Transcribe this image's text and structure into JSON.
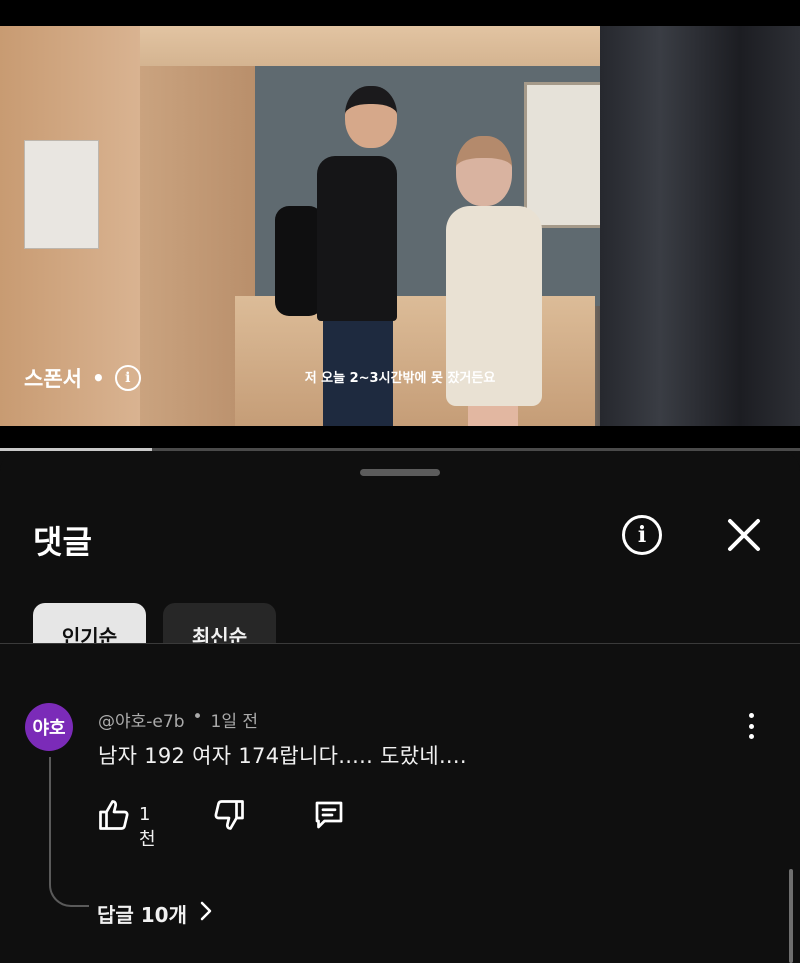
{
  "video": {
    "sponsor_label": "스폰서",
    "sponsor_dot": "•",
    "info_glyph": "i",
    "subtitle": "저 오늘 2~3시간밖에 못 잤거든요",
    "progress_fraction": 0.19
  },
  "comments_sheet": {
    "title": "댓글",
    "info_icon": "info-icon",
    "close_icon": "close-icon",
    "sort_chips": [
      {
        "label": "인기순",
        "selected": true
      },
      {
        "label": "최신순",
        "selected": false
      }
    ]
  },
  "comment": {
    "avatar_text": "야호",
    "avatar_color": "#7b2bb8",
    "author": "@야호-e7b",
    "separator": "•",
    "time": "1일 전",
    "text": "남자 192 여자 174랍니다..... 도랐네....",
    "like_count": "1천",
    "like_icon": "thumbs-up-icon",
    "dislike_icon": "thumbs-down-icon",
    "reply_icon": "reply-icon",
    "menu_icon": "more-vertical-icon",
    "replies_label": "답글 10개",
    "replies_chevron": "›"
  }
}
